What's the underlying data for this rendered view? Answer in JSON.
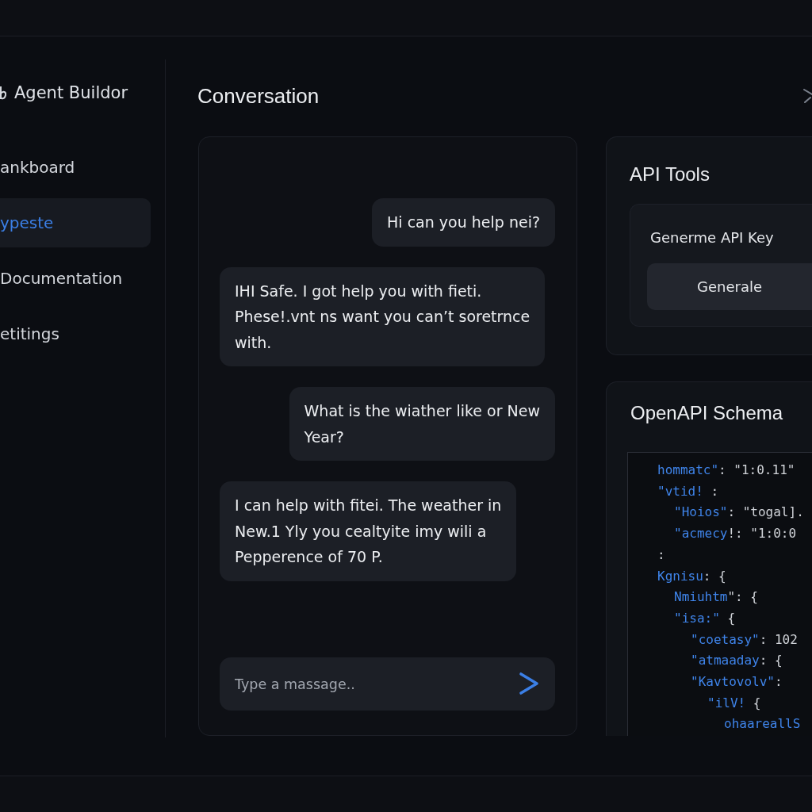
{
  "sidebar": {
    "brand": "Agent Buildor",
    "items": [
      {
        "label": "ankboard",
        "selected": false
      },
      {
        "label": "ypeste",
        "selected": true
      },
      {
        "label": "Documentation",
        "selected": false
      },
      {
        "label": "etitings",
        "selected": false
      }
    ]
  },
  "conversation": {
    "title": "Conversation",
    "messages": [
      {
        "kind": "user",
        "text": "Hi can you help nei?"
      },
      {
        "kind": "assistant",
        "text": "IHI Safe. I got help you with fieti.\nPhese!.vnt ns want you can’t soretrnce\nwith."
      },
      {
        "kind": "user",
        "text": "What is the wiather like or New\nYear?"
      },
      {
        "kind": "assistant",
        "text": "I can help with fitei. The weather in\nNew.1 Yly you cealtyite imy wili a\nPepperence of 70 P."
      }
    ],
    "input": {
      "placeholder": "Type a massage.."
    }
  },
  "api_tools": {
    "title": "API Tools",
    "generate_key": {
      "label": "Generme API Key",
      "button": "Generale"
    }
  },
  "openapi_schema": {
    "title": "OpenAPI Schema",
    "lines": [
      {
        "key": "hommatc\"",
        "text": ": \"1:0.11\""
      },
      {
        "key": "\"vtid!",
        "text": " :",
        "children": [
          {
            "key": "\"Hoios\"",
            "text": ": \"togal]."
          },
          {
            "key": "\"acmecy",
            "text": "!: \"1:0:0"
          }
        ]
      },
      {
        "text": ":"
      },
      {
        "key": "Kgnisu",
        "text": ": {",
        "children": [
          {
            "key": "Nmiuhtm",
            "text": "\": {"
          },
          {
            "key": "\"isa:\"",
            "text": " {",
            "children": [
              {
                "key": "\"coetasy\"",
                "text": ": 102"
              },
              {
                "key": "\"atmaaday",
                "text": ": {"
              },
              {
                "key": "\"Kavtovolv\"",
                "text": ":",
                "children": [
                  {
                    "key": "\"ilV!",
                    "text": " {",
                    "children": [
                      {
                        "key": "ohaareallS"
                      }
                    ]
                  }
                ]
              }
            ]
          }
        ]
      }
    ]
  }
}
